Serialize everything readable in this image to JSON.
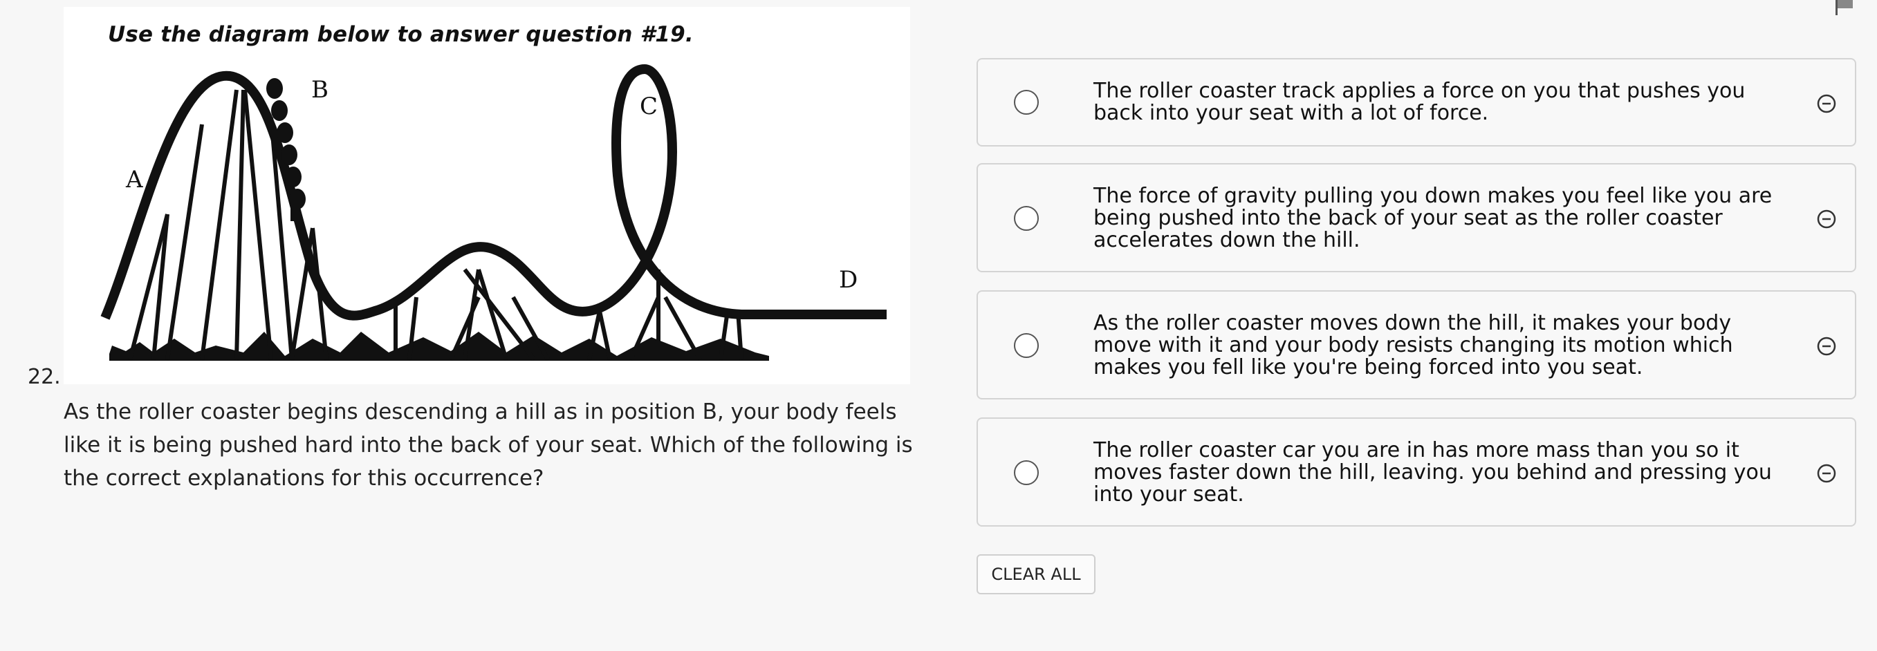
{
  "question": {
    "number": "22.",
    "figure_caption": "Use the diagram below to answer question #19.",
    "figure_labels": {
      "a": "A",
      "b": "B",
      "c": "C",
      "d": "D"
    },
    "text": "As the roller coaster begins descending a hill as in position B, your body feels like it is being pushed hard into the back of your seat.  Which of the following is the correct explanations for this occurrence?"
  },
  "answers": [
    {
      "text": "The roller coaster track applies a force on you that pushes you back into your seat with a lot of force."
    },
    {
      "text": "The force of gravity pulling you down makes you feel like you are being pushed into the back of your seat as the roller coaster accelerates down the hill."
    },
    {
      "text": "As the roller coaster moves down the hill, it makes your body move with it and your body resists changing its motion which makes you fell like you're being forced into you seat."
    },
    {
      "text": "The roller coaster car you are in has more mass than you so it moves faster down the hill, leaving. you behind and pressing you into your seat."
    }
  ],
  "controls": {
    "clear_all_label": "CLEAR ALL"
  },
  "icons": {
    "radio": "radio-circle",
    "eliminate": "minus-circle-icon",
    "flag": "flag-icon"
  }
}
